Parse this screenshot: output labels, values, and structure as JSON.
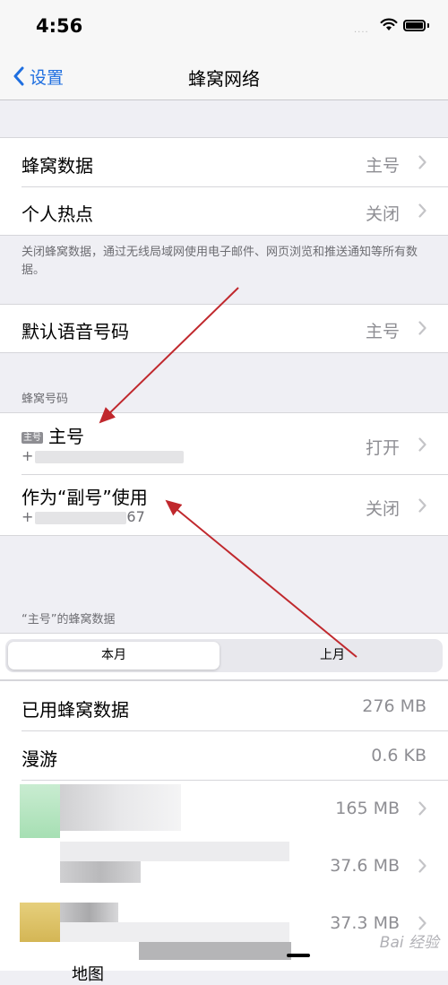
{
  "status_bar": {
    "time": "4:56",
    "signal": "....",
    "icons": [
      "wifi-icon",
      "battery-icon"
    ]
  },
  "nav": {
    "back_label": "设置",
    "title": "蜂窝网络"
  },
  "group1": {
    "cellular_data": {
      "label": "蜂窝数据",
      "value": "主号"
    },
    "hotspot": {
      "label": "个人热点",
      "value": "关闭"
    },
    "footnote": "关闭蜂窝数据，通过无线局域网使用电子邮件、网页浏览和推送通知等所有数据。"
  },
  "group2": {
    "default_voice": {
      "label": "默认语音号码",
      "value": "主号"
    }
  },
  "cellular_plans": {
    "header": "蜂窝号码",
    "primary": {
      "badge": "主号",
      "label": "主号",
      "number_prefix": "+",
      "value": "打开"
    },
    "secondary": {
      "label": "作为“副号”使用",
      "number_prefix": "+",
      "number_suffix": "67",
      "value": "关闭"
    }
  },
  "usage": {
    "header": "“主号”的蜂窝数据",
    "segments": [
      "本月",
      "上月"
    ],
    "selected_segment": "本月",
    "used": {
      "label": "已用蜂窝数据",
      "value": "276 MB"
    },
    "roaming": {
      "label": "漫游",
      "value": "0.6 KB"
    },
    "apps": [
      {
        "value": "165 MB"
      },
      {
        "value": "37.6 MB"
      },
      {
        "value": "37.3 MB"
      }
    ],
    "partial_label": "地图"
  },
  "watermark": "Bai 经验",
  "colors": {
    "accent": "#1f6fe0",
    "arrow": "#c0282d",
    "secondary_text": "#8e8e93"
  }
}
